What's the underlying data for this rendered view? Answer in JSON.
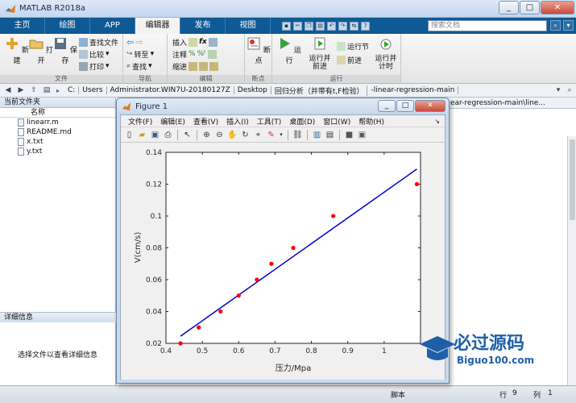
{
  "app": {
    "title": "MATLAB R2018a",
    "window_buttons": [
      "_",
      "□",
      "✕"
    ]
  },
  "ribbon_tabs": [
    "主页",
    "绘图",
    "APP",
    "编辑器",
    "发布",
    "视图"
  ],
  "active_tab": "编辑器",
  "search": {
    "placeholder": "搜索文档"
  },
  "ribbon": {
    "file_group": {
      "label": "文件",
      "new": "新建",
      "open": "打开",
      "save": "保存",
      "find_files": "查找文件",
      "compare": "比较",
      "print": "打印"
    },
    "nav_group": {
      "label": "导航",
      "goto": "转至",
      "find": "查找"
    },
    "edit_group": {
      "label": "编辑",
      "insert": "插入",
      "comment": "注释",
      "indent": "缩进",
      "fx": "fx"
    },
    "breakpoint_group": {
      "label": "断点",
      "breakpoints": "断点"
    },
    "run_group": {
      "label": "运行",
      "run": "运行",
      "run_advance": "运行并\n前进",
      "run_section": "运行节",
      "advance": "前进",
      "run_time": "运行并\n计时"
    }
  },
  "address": {
    "crumbs": [
      "C:",
      "Users",
      "Administrator.WIN7U-20180127Z",
      "Desktop",
      "回归分析（并带有t,F检验）",
      "-linear-regression-main"
    ]
  },
  "current_folder": {
    "title": "当前文件夹",
    "column": "名称",
    "files": [
      "linearr.m",
      "README.md",
      "x.txt",
      "y.txt"
    ]
  },
  "details": {
    "title": "详细信息",
    "message": "选择文件以查看详细信息"
  },
  "editor": {
    "tab_path": "ear-regression-main\\line..."
  },
  "statusbar": {
    "script": "脚本",
    "row_label": "行",
    "row": "9",
    "col_label": "列",
    "col": "1"
  },
  "figure": {
    "title": "Figure 1",
    "menu": [
      "文件(F)",
      "编辑(E)",
      "查看(V)",
      "插入(I)",
      "工具(T)",
      "桌面(D)",
      "窗口(W)",
      "帮助(H)"
    ],
    "toolbar_icons": [
      "new-icon",
      "open-icon",
      "save-icon",
      "print-icon",
      "pointer-icon",
      "zoom-in-icon",
      "zoom-out-icon",
      "pan-icon",
      "rotate-icon",
      "data-cursor-icon",
      "brush-icon",
      "link-icon",
      "colorbar-icon",
      "legend-icon",
      "hide-plot-tools-icon",
      "show-plot-tools-icon"
    ]
  },
  "watermark": {
    "line1": "必过源码",
    "line2": "Biguo100.com"
  },
  "chart_data": {
    "type": "scatter",
    "title": "",
    "xlabel": "压力/Mpa",
    "ylabel": "V(cm/s)",
    "xlim": [
      0.4,
      1.1
    ],
    "ylim": [
      0.02,
      0.14
    ],
    "xticks": [
      "0.4",
      "0.5",
      "0.6",
      "0.7",
      "0.8",
      "0.9",
      "1"
    ],
    "yticks": [
      "0.02",
      "0.04",
      "0.06",
      "0.08",
      "0.1",
      "0.12",
      "0.14"
    ],
    "grid": false,
    "series": [
      {
        "kind": "points",
        "color": "#ff0000",
        "x": [
          0.44,
          0.49,
          0.55,
          0.6,
          0.65,
          0.69,
          0.75,
          0.86,
          1.09
        ],
        "y": [
          0.02,
          0.03,
          0.04,
          0.05,
          0.06,
          0.07,
          0.08,
          0.1,
          0.12
        ]
      },
      {
        "kind": "fit-line",
        "color": "#0000cc",
        "x": [
          0.44,
          1.09
        ],
        "y": [
          0.0245,
          0.1295
        ]
      }
    ]
  }
}
